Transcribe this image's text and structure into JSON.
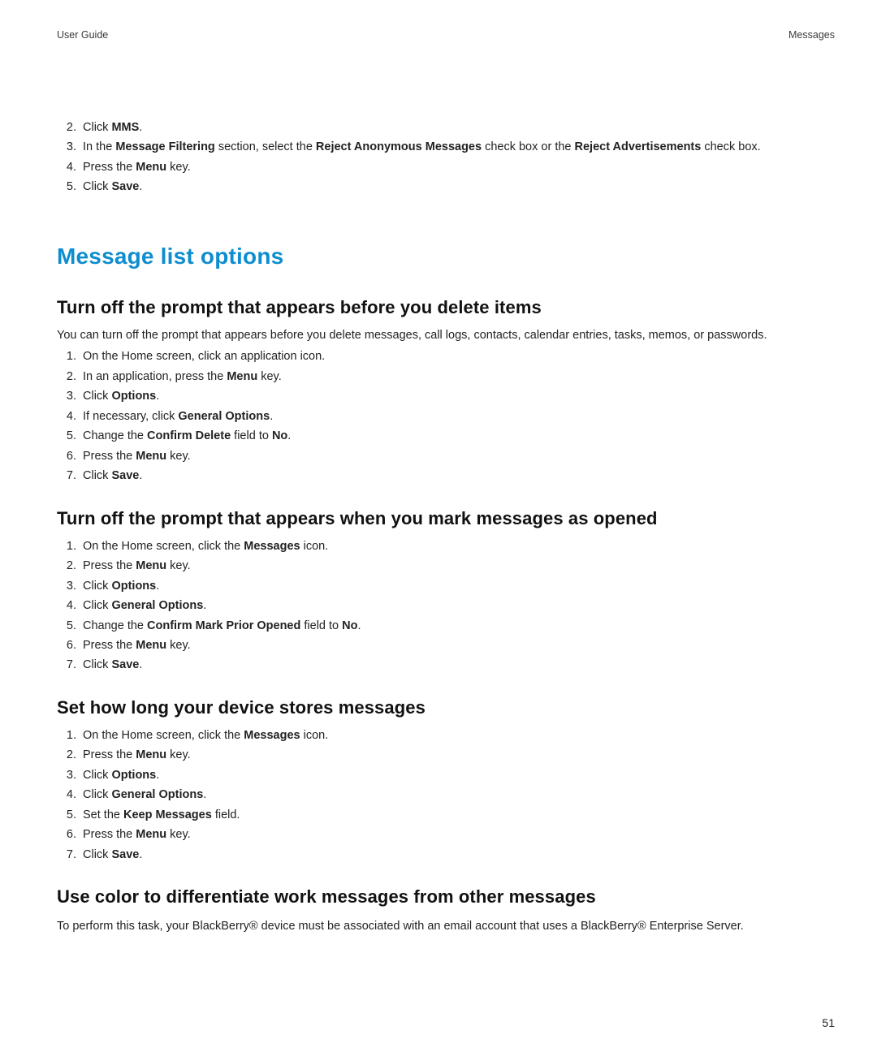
{
  "header": {
    "left": "User Guide",
    "right": "Messages"
  },
  "top_list": {
    "start": 2,
    "items": [
      {
        "pre": "Click ",
        "bold": "MMS",
        "post": "."
      },
      {
        "pre": "In the ",
        "bold": "Message Filtering",
        "mid": " section, select the ",
        "bold2": "Reject Anonymous Messages",
        "mid2": " check box or the ",
        "bold3": "Reject Advertisements",
        "post": " check box."
      },
      {
        "pre": "Press the ",
        "bold": "Menu",
        "post": " key."
      },
      {
        "pre": "Click ",
        "bold": "Save",
        "post": "."
      }
    ]
  },
  "section_title": "Message list options",
  "sub1": {
    "title": "Turn off the prompt that appears before you delete items",
    "intro": "You can turn off the prompt that appears before you delete messages, call logs, contacts, calendar entries, tasks, memos, or passwords.",
    "items": [
      {
        "pre": "On the Home screen, click an application icon."
      },
      {
        "pre": "In an application, press the ",
        "bold": "Menu",
        "post": " key."
      },
      {
        "pre": "Click ",
        "bold": "Options",
        "post": "."
      },
      {
        "pre": "If necessary, click ",
        "bold": "General Options",
        "post": "."
      },
      {
        "pre": "Change the ",
        "bold": "Confirm Delete",
        "mid": " field to ",
        "bold2": "No",
        "post": "."
      },
      {
        "pre": "Press the ",
        "bold": "Menu",
        "post": " key."
      },
      {
        "pre": "Click ",
        "bold": "Save",
        "post": "."
      }
    ]
  },
  "sub2": {
    "title": "Turn off the prompt that appears when you mark messages as opened",
    "items": [
      {
        "pre": "On the Home screen, click the ",
        "bold": "Messages",
        "post": " icon."
      },
      {
        "pre": "Press the ",
        "bold": "Menu",
        "post": " key."
      },
      {
        "pre": "Click ",
        "bold": "Options",
        "post": "."
      },
      {
        "pre": "Click ",
        "bold": "General Options",
        "post": "."
      },
      {
        "pre": "Change the ",
        "bold": "Confirm Mark Prior Opened",
        "mid": " field to ",
        "bold2": "No",
        "post": "."
      },
      {
        "pre": "Press the ",
        "bold": "Menu",
        "post": " key."
      },
      {
        "pre": "Click ",
        "bold": "Save",
        "post": "."
      }
    ]
  },
  "sub3": {
    "title": "Set how long your device stores messages",
    "items": [
      {
        "pre": "On the Home screen, click the ",
        "bold": "Messages",
        "post": " icon."
      },
      {
        "pre": "Press the ",
        "bold": "Menu",
        "post": " key."
      },
      {
        "pre": "Click ",
        "bold": "Options",
        "post": "."
      },
      {
        "pre": "Click ",
        "bold": "General Options",
        "post": "."
      },
      {
        "pre": "Set the ",
        "bold": "Keep Messages",
        "post": " field."
      },
      {
        "pre": "Press the ",
        "bold": "Menu",
        "post": " key."
      },
      {
        "pre": "Click ",
        "bold": "Save",
        "post": "."
      }
    ]
  },
  "sub4": {
    "title": "Use color to differentiate work messages from other messages",
    "intro": "To perform this task, your BlackBerry® device must be associated with an email account that uses a BlackBerry® Enterprise Server."
  },
  "page_number": "51"
}
